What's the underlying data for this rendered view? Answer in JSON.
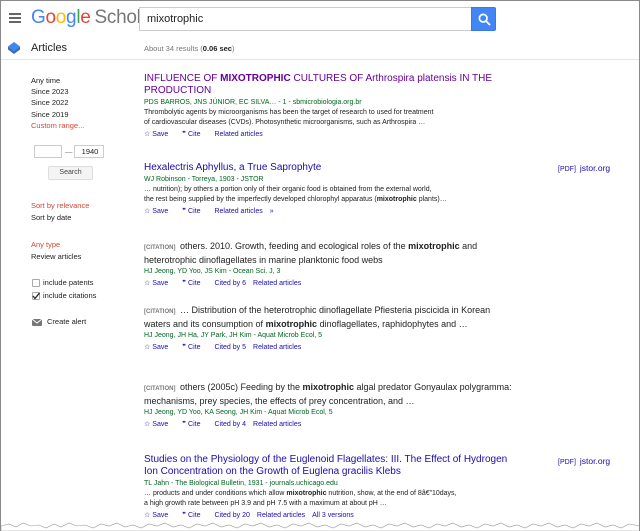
{
  "header": {
    "logo_google": "Google",
    "logo_scholar": "Scholar",
    "search_value": "mixotrophic",
    "section": "Articles",
    "stats_prefix": "About 34 results (",
    "stats_time": "0.06 sec",
    "stats_suffix": ")"
  },
  "sidebar": {
    "time_options": [
      "Any time",
      "Since 2023",
      "Since 2022",
      "Since 2019"
    ],
    "custom_range": "Custom range...",
    "year_from": "",
    "year_to": "1940",
    "search_button": "Search",
    "sort_relevance": "Sort by relevance",
    "sort_date": "Sort by date",
    "any_type": "Any type",
    "review_articles": "Review articles",
    "include_patents": "include patents",
    "include_citations": "include citations",
    "create_alert": "Create alert"
  },
  "results": [
    {
      "title_a": "INFLUENCE OF ",
      "title_b": "MIXOTROPHIC",
      "title_c": " CULTURES OF Arthrospira platensis IN THE PRODUCTION",
      "authors": "PDS BARROS, JNS JÚNIOR, EC SILVA… - 1 - sbmicrobiologia.org.br",
      "snippet1": "Thrombolytic agents by microorganisms has been the target of research to used for treatment",
      "snippet2": "of cardiovascular diseases (CVDs). Photosynthetic microorganisms, such as Arthrospira …",
      "save": "Save",
      "cite": "Cite",
      "related": "Related articles"
    },
    {
      "title": "Hexalectris Aphyllus, a True Saprophyte",
      "authors": "WJ Robinson - Torreya, 1903 - JSTOR",
      "snippet1": "… nutrition); by others a portion only of their organic food is obtained from the external world,",
      "snippet2a": "the rest being supplied by the imperfectly developed chlorophyl apparatus (",
      "snippet2b": "mixotrophic",
      "snippet2c": " plants)…",
      "save": "Save",
      "cite": "Cite",
      "related": "Related articles",
      "pdf_tag": "[PDF]",
      "pdf_site": "jstor.org"
    },
    {
      "tag": "[CITATION]",
      "title_a": " others. 2010. Growth, feeding and ecological roles of the ",
      "title_b": "mixotrophic",
      "title_c": " and heterotrophic dinoflagellates in marine planktonic food webs",
      "authors": "HJ Jeong, YD Yoo, JS Kim - Ocean Sci. J, 3",
      "save": "Save",
      "cite": "Cite",
      "cited": "Cited by 6",
      "related": "Related articles"
    },
    {
      "tag": "[CITATION]",
      "title_a": " … Distribution of the heterotrophic dinoflagellate Pfiesteria piscicida in Korean waters and its consumption of ",
      "title_b": "mixotrophic",
      "title_c": " dinoflagellates, raphidophytes and …",
      "authors": "HJ Jeong, JH Ha, JY Park, JH Kim - Aquat Microb Ecol, 5",
      "save": "Save",
      "cite": "Cite",
      "cited": "Cited by 5",
      "related": "Related articles"
    },
    {
      "tag": "[CITATION]",
      "title_a": " others (2005c) Feeding by the ",
      "title_b": "mixotrophic",
      "title_c": " algal predator Gonyaulax polygramma: mechanisms, prey species, the effects of prey concentration, and …",
      "authors": "HJ Jeong, YD Yoo, KA Seong, JH Kim - Aquat Microb Ecol, 5",
      "save": "Save",
      "cite": "Cite",
      "cited": "Cited by 4",
      "related": "Related articles"
    },
    {
      "title": "Studies on the Physiology of the Euglenoid Flagellates: III. The Effect of Hydrogen Ion Concentration on the Growth of Euglena gracilis Klebs",
      "authors": "TL Jahn - The Biological Bulletin, 1931 - journals.uchicago.edu",
      "snippet1a": "… products and under conditions which allow ",
      "snippet1b": "mixotrophic",
      "snippet1c": " nutrition, show, at the end of 8â€”10days,",
      "snippet2": "a high growth rate between pH 3.9 and pH 7.5 with a maximum at about pH …",
      "save": "Save",
      "cite": "Cite",
      "cited": "Cited by 20",
      "related": "Related articles",
      "versions": "All 3 versions",
      "pdf_tag": "[PDF]",
      "pdf_site": "jstor.org"
    }
  ]
}
